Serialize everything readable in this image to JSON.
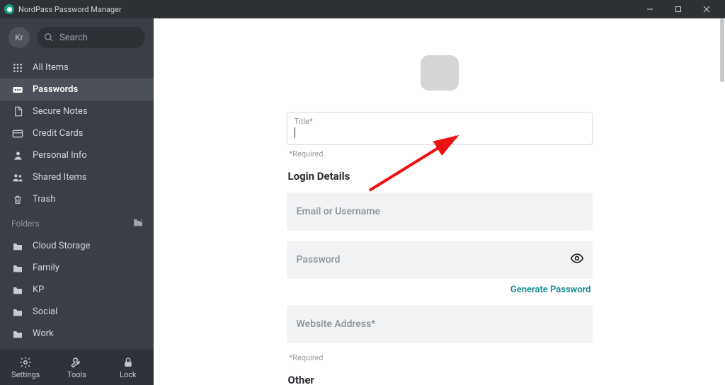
{
  "window": {
    "title": "NordPass Password Manager"
  },
  "sidebar": {
    "avatar_initials": "Kr",
    "search_placeholder": "Search",
    "items": [
      {
        "label": "All Items"
      },
      {
        "label": "Passwords"
      },
      {
        "label": "Secure Notes"
      },
      {
        "label": "Credit Cards"
      },
      {
        "label": "Personal Info"
      },
      {
        "label": "Shared Items"
      },
      {
        "label": "Trash"
      }
    ],
    "folders_header": "Folders",
    "folders": [
      {
        "label": "Cloud Storage"
      },
      {
        "label": "Family"
      },
      {
        "label": "KP"
      },
      {
        "label": "Social"
      },
      {
        "label": "Work"
      }
    ],
    "bottom": {
      "settings": "Settings",
      "tools": "Tools",
      "lock": "Lock"
    }
  },
  "form": {
    "title_label": "Title*",
    "title_value": "",
    "required_text": "*Required",
    "login_section": "Login Details",
    "email_placeholder": "Email or Username",
    "password_placeholder": "Password",
    "generate_link": "Generate Password",
    "website_placeholder": "Website Address*",
    "other_section": "Other"
  }
}
